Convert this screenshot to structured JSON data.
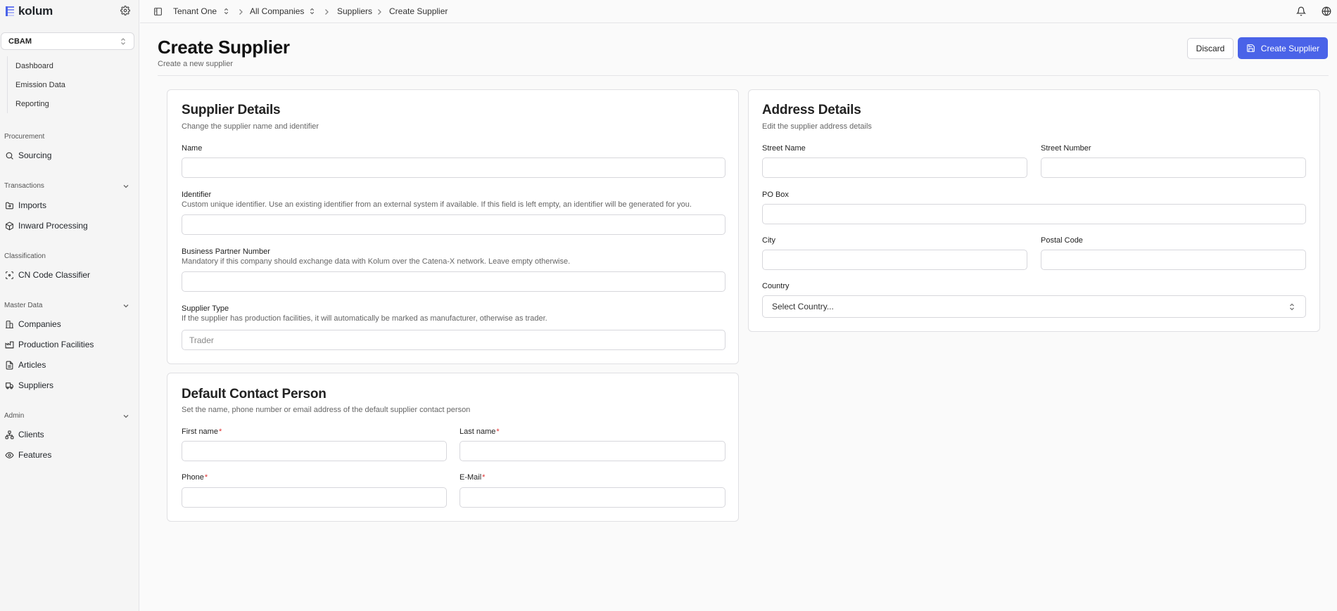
{
  "app": {
    "brand": "kolum",
    "module": "CBAM"
  },
  "sidebar": {
    "subnav": [
      "Dashboard",
      "Emission Data",
      "Reporting"
    ],
    "sections": {
      "procurement": {
        "title": "Procurement",
        "items": [
          "Sourcing"
        ]
      },
      "transactions": {
        "title": "Transactions",
        "items": [
          "Imports",
          "Inward Processing"
        ]
      },
      "classification": {
        "title": "Classification",
        "items": [
          "CN Code Classifier"
        ]
      },
      "master_data": {
        "title": "Master Data",
        "items": [
          "Companies",
          "Production Facilities",
          "Articles",
          "Suppliers"
        ]
      },
      "admin": {
        "title": "Admin",
        "items": [
          "Clients",
          "Features"
        ]
      }
    }
  },
  "topbar": {
    "breadcrumb": [
      "Tenant One",
      "All Companies",
      "Suppliers",
      "Create Supplier"
    ]
  },
  "header": {
    "title": "Create Supplier",
    "subtitle": "Create a new supplier",
    "discard_label": "Discard",
    "create_label": "Create Supplier"
  },
  "supplier_details": {
    "title": "Supplier Details",
    "subtitle": "Change the supplier name and identifier",
    "name_label": "Name",
    "name_value": "",
    "identifier_label": "Identifier",
    "identifier_help": "Custom unique identifier. Use an existing identifier from an external system if available. If this field is left empty, an identifier will be generated for you.",
    "identifier_value": "",
    "bpn_label": "Business Partner Number",
    "bpn_help": "Mandatory if this company should exchange data with Kolum over the Catena-X network. Leave empty otherwise.",
    "bpn_value": "",
    "type_label": "Supplier Type",
    "type_help": "If the supplier has production facilities, it will automatically be marked as manufacturer, otherwise as trader.",
    "type_placeholder": "Trader"
  },
  "contact": {
    "title": "Default Contact Person",
    "subtitle": "Set the name, phone number or email address of the default supplier contact person",
    "first_name_label": "First name",
    "last_name_label": "Last name",
    "phone_label": "Phone",
    "email_label": "E-Mail",
    "required_mark": "*"
  },
  "address": {
    "title": "Address Details",
    "subtitle": "Edit the supplier address details",
    "street_name_label": "Street Name",
    "street_number_label": "Street Number",
    "po_box_label": "PO Box",
    "city_label": "City",
    "postal_code_label": "Postal Code",
    "country_label": "Country",
    "country_placeholder": "Select Country..."
  },
  "colors": {
    "accent": "#4a63e8",
    "required": "#e03131"
  }
}
